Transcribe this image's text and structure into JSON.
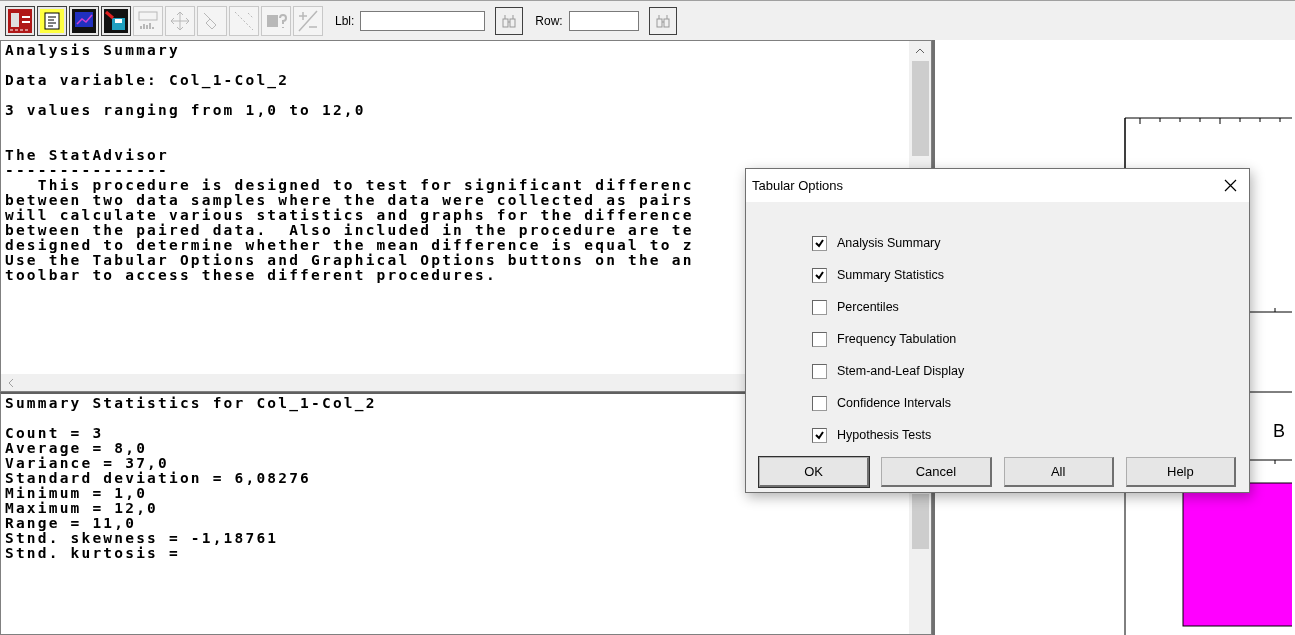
{
  "toolbar": {
    "buttons": [
      {
        "kind": "tables",
        "disabled": false
      },
      {
        "kind": "text",
        "disabled": false
      },
      {
        "kind": "graph",
        "disabled": false
      },
      {
        "kind": "save",
        "disabled": false
      },
      {
        "kind": "label",
        "disabled": true
      },
      {
        "kind": "move",
        "disabled": true
      },
      {
        "kind": "brush",
        "disabled": true
      },
      {
        "kind": "points",
        "disabled": true
      },
      {
        "kind": "help",
        "disabled": true
      },
      {
        "kind": "plusminus",
        "disabled": true
      }
    ],
    "label_search": {
      "label": "Lbl:"
    },
    "row_search": {
      "label": "Row:"
    }
  },
  "analysis_pane": {
    "paragraphs": [
      {
        "kind": "block",
        "lines": [
          "Analysis Summary"
        ]
      },
      {
        "kind": "block",
        "lines": [
          "Data variable: Col_1-Col_2"
        ]
      },
      {
        "kind": "block",
        "lines": [
          "3 values ranging from 1,0 to 12,0"
        ]
      },
      {
        "kind": "section",
        "lines": [
          "The StatAdvisor",
          "---------------",
          "   This procedure is designed to test for significant differenc",
          "between two data samples where the data were collected as pairs",
          "will calculate various statistics and graphs for the difference",
          "between the paired data.  Also included in the procedure are te",
          "designed to determine whether the mean difference is equal to z",
          "Use the Tabular Options and Graphical Options buttons on the an",
          "toolbar to access these different procedures."
        ]
      }
    ]
  },
  "statistics_pane": {
    "paragraphs": [
      {
        "kind": "block",
        "lines": [
          "Summary Statistics for Col_1-Col_2"
        ]
      },
      {
        "kind": "block",
        "lines": [
          "Count = 3",
          "Average = 8,0",
          "Variance = 37,0",
          "Standard deviation = 6,08276",
          "Minimum = 1,0",
          "Maximum = 12,0",
          "Range = 11,0",
          "Stnd. skewness = -1,18761",
          "Stnd. kurtosis ="
        ]
      }
    ]
  },
  "graph_pane": {
    "label": "B"
  },
  "dialog": {
    "title": "Tabular Options",
    "options": [
      {
        "label": "Analysis Summary",
        "checked": true
      },
      {
        "label": "Summary Statistics",
        "checked": true
      },
      {
        "label": "Percentiles",
        "checked": false
      },
      {
        "label": "Frequency Tabulation",
        "checked": false
      },
      {
        "label": "Stem-and-Leaf Display",
        "checked": false
      },
      {
        "label": "Confidence Intervals",
        "checked": false
      },
      {
        "label": "Hypothesis Tests",
        "checked": true
      }
    ],
    "buttons": [
      {
        "label": "OK",
        "default": true
      },
      {
        "label": "Cancel",
        "default": false
      },
      {
        "label": "All",
        "default": false
      },
      {
        "label": "Help",
        "default": false
      }
    ]
  }
}
